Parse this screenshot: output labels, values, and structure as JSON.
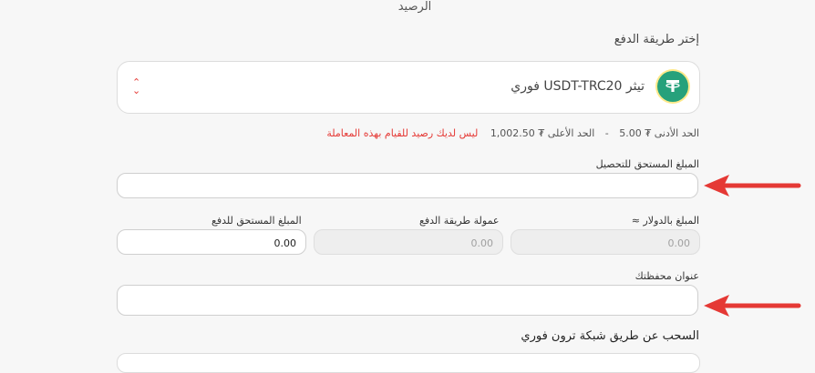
{
  "header": {
    "balance_label": "الرصيد"
  },
  "payment_method": {
    "section_label": "إختر طريقة الدفع",
    "selected": "تيثر USDT-TRC20 فوري",
    "icon": "tether-icon",
    "icon_color": "#26a17b"
  },
  "limits": {
    "min": "الحد الأدنى ₮ 5.00",
    "separator": "-",
    "max": "الحد الأعلى ₮ 1,002.50",
    "error": "ليس لديك رصيد للقيام بهذه المعاملة",
    "error_color": "#e53935"
  },
  "amount_due_field": {
    "label": "المبلغ المستحق للتحصيل",
    "value": ""
  },
  "amount_usd": {
    "label": "المبلغ بالدولار ≈",
    "value": "0.00"
  },
  "fee": {
    "label": "عمولة طريقة الدفع",
    "value": "0.00"
  },
  "amount_to_pay": {
    "label": "المبلغ المستحق للدفع",
    "value": "0.00"
  },
  "wallet_address": {
    "label": "عنوان محفظتك",
    "value": ""
  },
  "withdraw_note": "السحب عن طريق شبكة ترون فوري",
  "annotation_color": "#e53935"
}
